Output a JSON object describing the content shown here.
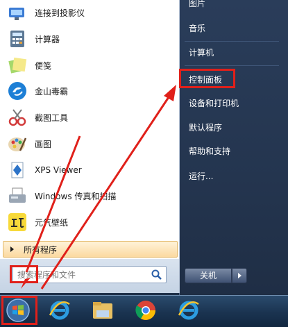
{
  "right_menu": {
    "items": [
      {
        "label": "图片"
      },
      {
        "label": "音乐"
      },
      {
        "label": "计算机"
      },
      {
        "label": "控制面板"
      },
      {
        "label": "设备和打印机"
      },
      {
        "label": "默认程序"
      },
      {
        "label": "帮助和支持"
      },
      {
        "label": "运行..."
      }
    ],
    "shutdown_label": "关机"
  },
  "programs": [
    {
      "label": "连接到投影仪",
      "icon": "projector-icon"
    },
    {
      "label": "计算器",
      "icon": "calculator-icon"
    },
    {
      "label": "便笺",
      "icon": "sticky-notes-icon"
    },
    {
      "label": "金山毒霸",
      "icon": "kingsoft-antivirus-icon"
    },
    {
      "label": "截图工具",
      "icon": "snipping-tool-icon"
    },
    {
      "label": "画图",
      "icon": "paint-icon"
    },
    {
      "label": "XPS Viewer",
      "icon": "xps-viewer-icon"
    },
    {
      "label": "Windows 传真和扫描",
      "icon": "fax-scan-icon"
    },
    {
      "label": "元气壁纸",
      "icon": "yuanqi-wallpaper-icon"
    }
  ],
  "all_programs_label": "所有程序",
  "search": {
    "placeholder": "搜索程序和文件"
  },
  "taskbar": {
    "items": [
      "start-orb-icon",
      "ie-icon",
      "file-explorer-icon",
      "chrome-icon",
      "ie-icon"
    ]
  },
  "colors": {
    "highlight_box": "#e0201a",
    "arrow": "#e0201a"
  }
}
